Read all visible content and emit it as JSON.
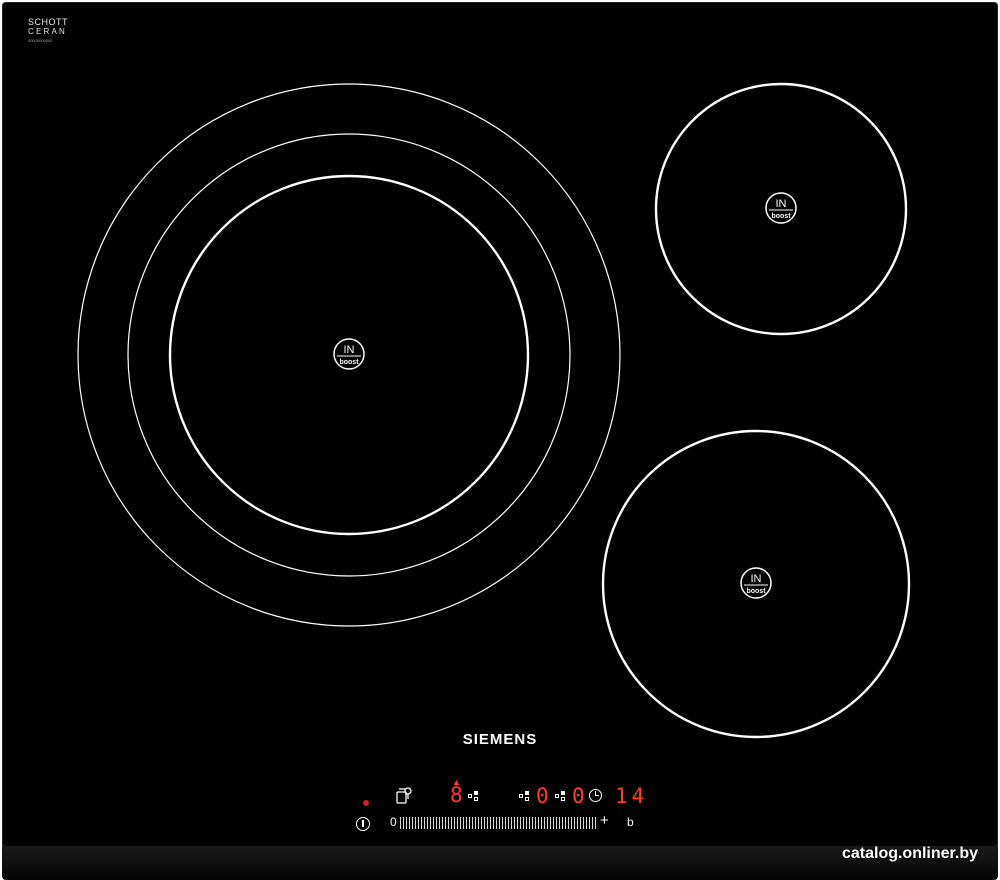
{
  "glass_label": {
    "line1": "SCHOTT",
    "line2": "CERAN",
    "line3": "00000000000"
  },
  "brand": "SIEMENS",
  "zones": [
    {
      "name": "large-zone",
      "badge_top": "IN",
      "badge_bottom": "boost"
    },
    {
      "name": "small-zone",
      "badge_top": "IN",
      "badge_bottom": "boost"
    },
    {
      "name": "medium-zone",
      "badge_top": "IN",
      "badge_bottom": "boost"
    }
  ],
  "controls": {
    "slider_min": "0",
    "slider_plus": "+",
    "b_label": "b",
    "power_level": "8",
    "timer_zone_a": "0",
    "timer_zone_b": "0",
    "timer_value": "14"
  },
  "colors": {
    "glass": "#000000",
    "display": "#ff3b2a",
    "indicator": "#e21b1b"
  },
  "watermark": "catalog.onliner.by"
}
